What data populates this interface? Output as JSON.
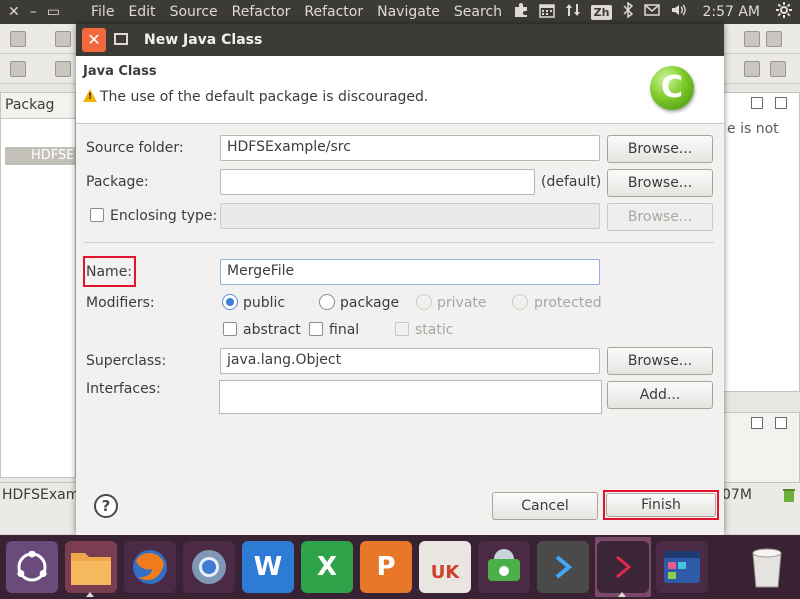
{
  "menubar": {
    "window_controls": [
      "✕",
      "–",
      "▭"
    ],
    "menus": [
      "File",
      "Edit",
      "Source",
      "Refactor",
      "Refactor",
      "Navigate",
      "Search"
    ],
    "clock": "2:57 AM",
    "input_method": "Zh"
  },
  "workbench": {
    "package_tab_label": "Packag",
    "tree_node": "HDFSE",
    "right_panel_text": "e is not",
    "status_text": "HDFSExam",
    "memory_text": "07M"
  },
  "dialog": {
    "title": "New Java Class",
    "banner_title": "Java Class",
    "banner_message": "The use of the default package is discouraged.",
    "logo_letter": "C",
    "source_folder": {
      "label": "Source folder:",
      "value": "HDFSExample/src",
      "button": "Browse..."
    },
    "package": {
      "label": "Package:",
      "value": "",
      "suffix": "(default)",
      "button": "Browse..."
    },
    "enclosing_type": {
      "label": "Enclosing type:",
      "value": "",
      "button": "Browse...",
      "checked": false
    },
    "name": {
      "label": "Name:",
      "value": "MergeFile"
    },
    "modifiers": {
      "label": "Modifiers:",
      "access": [
        {
          "label": "public",
          "selected": true,
          "enabled": true
        },
        {
          "label": "package",
          "selected": false,
          "enabled": true
        },
        {
          "label": "private",
          "selected": false,
          "enabled": false
        },
        {
          "label": "protected",
          "selected": false,
          "enabled": false
        }
      ],
      "flags": [
        {
          "label": "abstract",
          "checked": false,
          "enabled": true
        },
        {
          "label": "final",
          "checked": false,
          "enabled": true
        },
        {
          "label": "static",
          "checked": false,
          "enabled": false
        }
      ]
    },
    "superclass": {
      "label": "Superclass:",
      "value": "java.lang.Object",
      "button": "Browse..."
    },
    "interfaces": {
      "label": "Interfaces:",
      "button": "Add..."
    },
    "help_glyph": "?",
    "cancel_label": "Cancel",
    "finish_label": "Finish"
  },
  "dock": {
    "items": [
      "ubuntu-dash",
      "files",
      "firefox",
      "chromium",
      "writer",
      "calc",
      "impress",
      "ubuntu-software",
      "update-manager",
      "vscode",
      "terminal-arrow",
      "workspace",
      "trash"
    ],
    "writer_glyph": "W",
    "calc_glyph": "X",
    "impress_glyph": "P",
    "software_glyph": "UK"
  },
  "colors": {
    "accent_red": "#e0142e",
    "close_orange": "#f0683c",
    "menubar_bg": "#3c3b37",
    "dock_bg": "#3a2235",
    "radio_blue": "#3f7dd4"
  }
}
